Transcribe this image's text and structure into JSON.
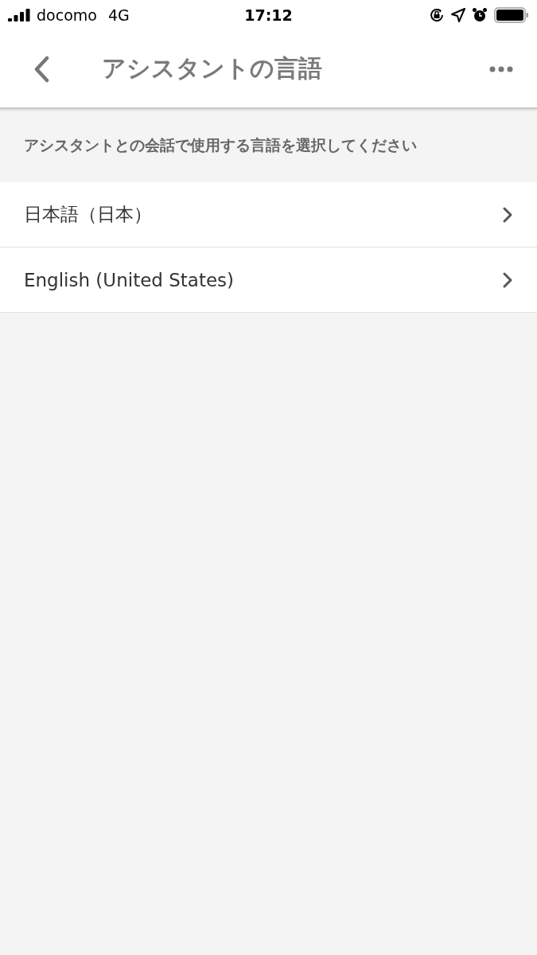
{
  "status_bar": {
    "carrier": "docomo",
    "network": "4G",
    "time": "17:12"
  },
  "header": {
    "title": "アシスタントの言語"
  },
  "section": {
    "description": "アシスタントとの会話で使用する言語を選択してください"
  },
  "languages": [
    {
      "label": "日本語（日本）"
    },
    {
      "label": "English (United States)"
    }
  ]
}
